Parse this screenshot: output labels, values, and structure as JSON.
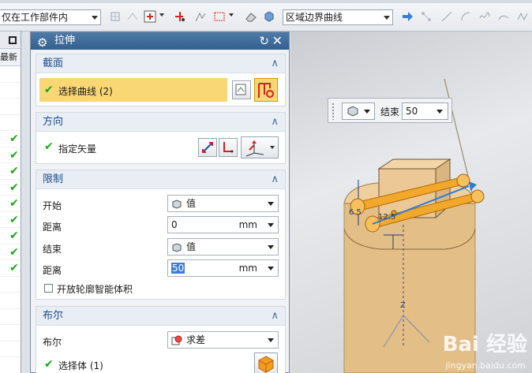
{
  "toolbar": {
    "assembly_filter": "仅在工作部件内",
    "curve_rule": "区域边界曲线"
  },
  "navigator": {
    "column_header": "最新",
    "checked_rows": 9
  },
  "dialog": {
    "title": "拉伸",
    "section": {
      "header": "截面",
      "select_curve": "选择曲线 (2)"
    },
    "direction": {
      "header": "方向",
      "specify_vector": "指定矢量"
    },
    "limits": {
      "header": "限制",
      "start_label": "开始",
      "start_type": "值",
      "start_distance_label": "距离",
      "start_distance": "0",
      "start_unit": "mm",
      "end_label": "结束",
      "end_type": "值",
      "end_distance_label": "距离",
      "end_distance": "50",
      "end_unit": "mm",
      "open_profile": "开放轮廓智能体积"
    },
    "boolean": {
      "header": "布尔",
      "boolean_label": "布尔",
      "boolean_type": "求差",
      "select_body": "选择体 (1)"
    }
  },
  "viewport": {
    "handle": {
      "end_label": "结束",
      "end_value": "50"
    },
    "dimension_labels": [
      "12.5",
      "6.5"
    ],
    "axis_label": "Z",
    "watermark": "Bai 经验",
    "watermark_url": "jingyan.baidu.com"
  },
  "colors": {
    "selected": "#f8d774",
    "title_bar": "#34608f",
    "solid": "#e3be87",
    "pin": "#f0a91c",
    "check": "#1aa51a"
  }
}
